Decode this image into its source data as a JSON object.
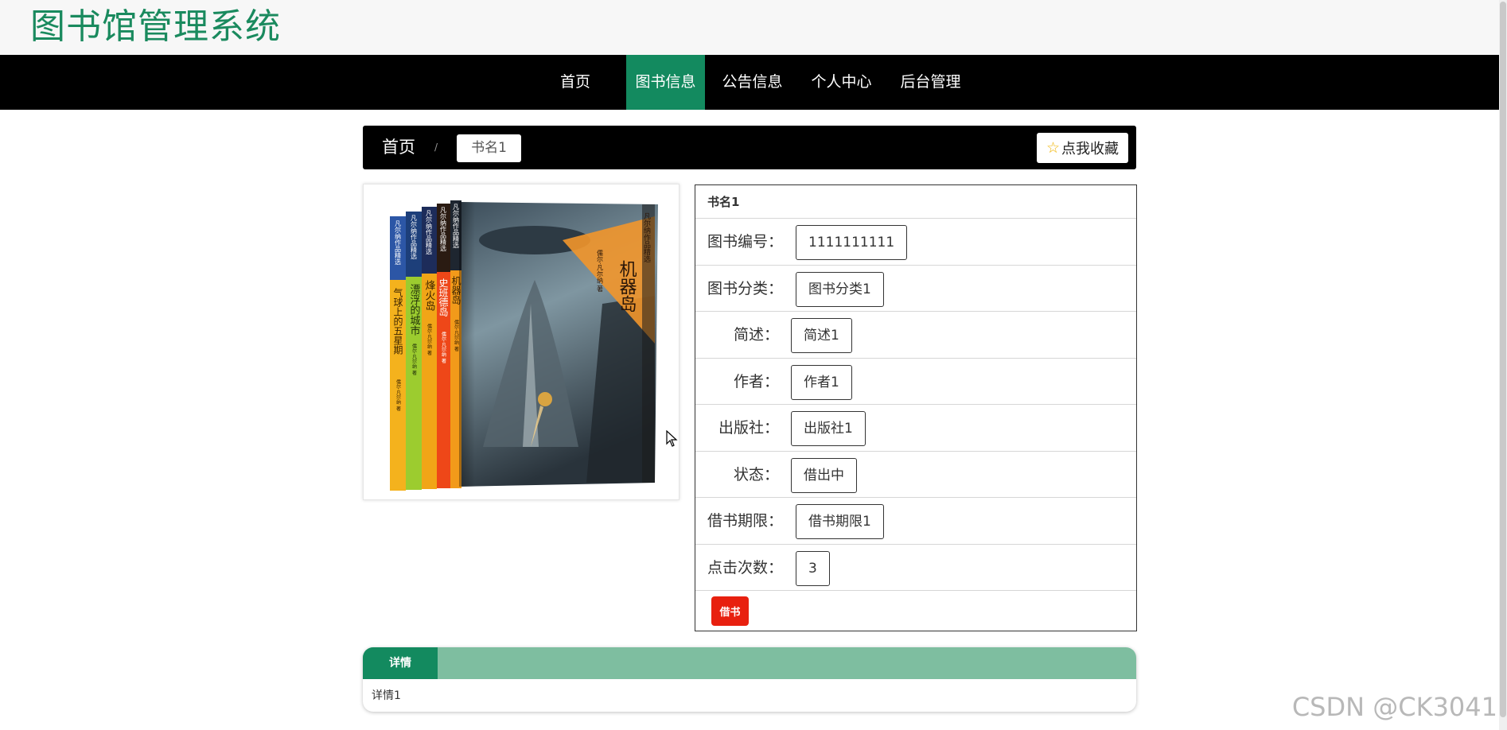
{
  "site": {
    "title": "图书馆管理系统"
  },
  "nav": {
    "items": [
      {
        "label": "首页"
      },
      {
        "label": "图书信息",
        "active": true
      },
      {
        "label": "公告信息"
      },
      {
        "label": "个人中心"
      },
      {
        "label": "后台管理"
      }
    ]
  },
  "breadcrumb": {
    "home": "首页",
    "separator": "/",
    "current": "书名1"
  },
  "favorite": {
    "label": "点我收藏",
    "icon": "star-icon"
  },
  "book_cover": {
    "spines": [
      {
        "series": "凡尔纳作品精选",
        "title": "气球上的五星期",
        "author": "儒尔·凡尔纳 著",
        "color": "#f4b21d"
      },
      {
        "series": "凡尔纳作品精选",
        "title": "漂浮的城市",
        "author": "儒尔·凡尔纳 著",
        "color": "#9ccc2f"
      },
      {
        "series": "凡尔纳作品精选",
        "title": "烽火岛",
        "author": "儒尔·凡尔纳 著",
        "color": "#f1a517"
      },
      {
        "series": "凡尔纳作品精选",
        "title": "史班德岛",
        "author": "儒尔·凡尔纳 著",
        "color": "#ee4718"
      },
      {
        "series": "凡尔纳作品精选",
        "title": "机器岛",
        "author": "儒尔·凡尔纳 著",
        "color": "#f29a1a"
      }
    ],
    "front_title": "机器岛",
    "front_series": "凡尔纳作品精选",
    "front_author": "儒尔·凡尔纳 著"
  },
  "details": {
    "title": "书名1",
    "fields": [
      {
        "label": "图书编号：",
        "value": "1111111111"
      },
      {
        "label": "图书分类：",
        "value": "图书分类1"
      },
      {
        "label": "简述：",
        "value": "简述1"
      },
      {
        "label": "作者：",
        "value": "作者1"
      },
      {
        "label": "出版社：",
        "value": "出版社1"
      },
      {
        "label": "状态：",
        "value": "借出中"
      },
      {
        "label": "借书期限：",
        "value": "借书期限1"
      },
      {
        "label": "点击次数：",
        "value": "3"
      }
    ],
    "borrow_label": "借书"
  },
  "tabs": {
    "active_label": "详情",
    "content": "详情1"
  },
  "watermark": "CSDN @CK3041",
  "colors": {
    "brand_green": "#138a5f",
    "logo_green": "#1a8a5e",
    "tab_bar_green": "#7ebea0",
    "borrow_red": "#e8200f",
    "nav_black": "#000000"
  }
}
